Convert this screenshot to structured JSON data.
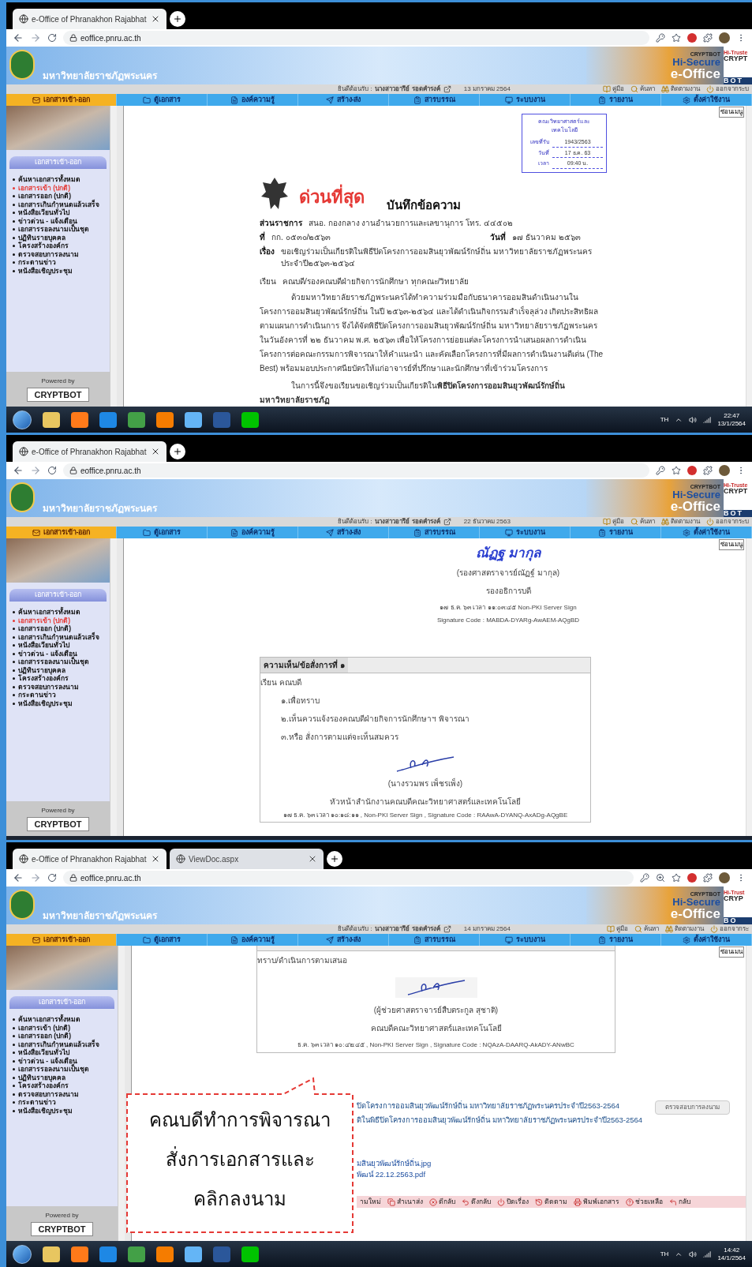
{
  "panels": [
    {
      "browser": {
        "tabs": [
          {
            "title": "e-Office of Phranakhon Rajabhat",
            "selected": true
          }
        ],
        "url": "eoffice.pnru.ac.th",
        "zoom_icon": false
      },
      "site": {
        "university": "มหาวิทยาลัยราชภัฏพระนคร",
        "logo_texts": [
          "CRYPTBOT",
          "Hi-Secure",
          "e-Office",
          "Hi-Truste",
          "CRYPT",
          "BOT"
        ],
        "welcome": "ยินดีต้อนรับ :",
        "user": "นางสาวอารีย์ รอดคำรงค์",
        "date": "13 มกราคม 2564",
        "links": [
          "คู่มือ",
          "ค้นหา",
          "ติดตามงาน",
          "ออกจากระบ"
        ],
        "hide_menu": "ซ่อนเมนู"
      },
      "menu": [
        {
          "label": "เอกสารเข้า-ออก",
          "selected": true
        },
        {
          "label": "ตู้เอกสาร",
          "selected": false
        },
        {
          "label": "องค์ความรู้",
          "selected": false
        },
        {
          "label": "สร้าง-ส่ง",
          "selected": false
        },
        {
          "label": "สารบรรณ",
          "selected": false
        },
        {
          "label": "ระบบงาน",
          "selected": false
        },
        {
          "label": "รายงาน",
          "selected": false
        },
        {
          "label": "ตั้งค่าใช้งาน",
          "selected": false
        }
      ],
      "sidebar": {
        "heading": "เอกสารเข้า-ออก",
        "items": [
          {
            "label": "ค้นหาเอกสารทั้งหมด",
            "selected": false
          },
          {
            "label": "เอกสารเข้า (ปกติ)",
            "selected": true
          },
          {
            "label": "เอกสารออก (ปกติ)",
            "selected": false
          },
          {
            "label": "เอกสารเกินกำหนดแล้วเสร็จ",
            "selected": false
          },
          {
            "label": "หนังสือเวียนทั่วไป",
            "selected": false
          },
          {
            "label": "ข่าวด่วน - แจ้งเตือน",
            "selected": false
          },
          {
            "label": "เอกสารรอลงนามเป็นชุด",
            "selected": false
          },
          {
            "label": "ปฏิทินรายบุคคล",
            "selected": false
          },
          {
            "label": "โครงสร้างองค์กร",
            "selected": false
          },
          {
            "label": "ตรวจสอบการลงนาม",
            "selected": false
          },
          {
            "label": "กระดานข่าว",
            "selected": false
          },
          {
            "label": "หนังสือเชิญประชุม",
            "selected": false
          }
        ],
        "powered_by": "Powered by",
        "vendor": "CRYPTBOT"
      },
      "content": {
        "kind": "memo",
        "stamp": {
          "title": "คณะวิทยาศาสตร์และเทคโนโลยี",
          "rows": [
            {
              "label": "เลขที่รับ",
              "value": "1943/2563"
            },
            {
              "label": "วันที่",
              "value": "17 ธ.ค. 63"
            },
            {
              "label": "เวลา",
              "value": "09:40 น."
            }
          ]
        },
        "urgency": "ด่วนที่สุด",
        "doc_title": "บันทึกข้อความ",
        "fields": [
          {
            "label": "ส่วนราชการ",
            "value": "สนอ. กองกลาง งานอำนวยการและเลขานุการ  โทร. ๔๔๕๐๒"
          },
          {
            "label": "ที่",
            "value": "กก. ๐๕๓๐/๒๕๖๓",
            "extra_label": "วันที่",
            "extra_value": "๑๗ ธันวาคม ๒๕๖๓"
          },
          {
            "label": "เรื่อง",
            "value": "ขอเชิญร่วมเป็นเกียรติในพิธีปิดโครงการออมสินยุวพัฒน์รักษ์ถิ่น มหาวิทยาลัยราชภัฏพระนครประจำปี๒๕๖๓-๒๕๖๔"
          }
        ],
        "salutation": {
          "label": "เรียน",
          "value": "คณบดี/รองคณบดีฝ่ายกิจการนักศึกษา ทุกคณะ/วิทยาลัย"
        },
        "paragraphs": [
          "ด้วยมหาวิทยาลัยราชภัฏพระนครได้ทำความร่วมมือกับธนาคารออมสินดำเนินงานในโครงการออมสินยุวพัฒน์รักษ์ถิ่น ในปี ๒๕๖๓-๒๕๖๔ และได้ดำเนินกิจกรรมสำเร็จลุล่วง เกิดประสิทธิผลตามแผนการดำเนินการ จึงได้จัดพิธีปิดโครงการออมสินยุวพัฒน์รักษ์ถิ่น มหาวิทยาลัยราชภัฏพระนคร ในวันอังคารที่ ๒๒ ธันวาคม พ.ศ. ๒๕๖๓ เพื่อให้โครงการย่อยแต่ละโครงการนำเสนอผลการดำเนินโครงการต่อคณะกรรมการพิจารณาให้คำแนะนำ และคัดเลือกโครงการที่มีผลการดำเนินงานดีเด่น (The Best) พร้อมมอบประกาศนียบัตรให้แก่อาจารย์ที่ปรึกษาและนักศึกษาที่เข้าร่วมโครงการ",
          "ในการนี้จึงขอเรียนขอเชิญร่วมเป็นเกียรติใน**พิธีปิดโครงการออมสินยุวพัฒน์รักษ์ถิ่น มหาวิทยาลัยราชภัฏ**"
        ]
      },
      "taskbar": {
        "language": "TH",
        "time": "22:47",
        "date": "13/1/2564"
      }
    },
    {
      "browser": {
        "tabs": [
          {
            "title": "e-Office of Phranakhon Rajabhat",
            "selected": true
          }
        ],
        "url": "eoffice.pnru.ac.th",
        "zoom_icon": false
      },
      "site": {
        "university": "มหาวิทยาลัยราชภัฏพระนคร",
        "logo_texts": [
          "CRYPTBOT",
          "Hi-Secure",
          "e-Office",
          "Hi-Truste",
          "CRYPT",
          "BOT"
        ],
        "welcome": "ยินดีต้อนรับ :",
        "user": "นางสาวอารีย์ รอดคำรงค์",
        "date": "22 ธันวาคม 2563",
        "links": [
          "คู่มือ",
          "ค้นหา",
          "ติดตามงาน",
          "ออกจากระบ"
        ],
        "hide_menu": "ซ่อนเมนู"
      },
      "menu": [
        {
          "label": "เอกสารเข้า-ออก",
          "selected": true
        },
        {
          "label": "ตู้เอกสาร",
          "selected": false
        },
        {
          "label": "องค์ความรู้",
          "selected": false
        },
        {
          "label": "สร้าง-ส่ง",
          "selected": false
        },
        {
          "label": "สารบรรณ",
          "selected": false
        },
        {
          "label": "ระบบงาน",
          "selected": false
        },
        {
          "label": "รายงาน",
          "selected": false
        },
        {
          "label": "ตั้งค่าใช้งาน",
          "selected": false
        }
      ],
      "sidebar": {
        "heading": "เอกสารเข้า-ออก",
        "items": [
          {
            "label": "ค้นหาเอกสารทั้งหมด",
            "selected": false
          },
          {
            "label": "เอกสารเข้า (ปกติ)",
            "selected": true
          },
          {
            "label": "เอกสารออก (ปกติ)",
            "selected": false
          },
          {
            "label": "เอกสารเกินกำหนดแล้วเสร็จ",
            "selected": false
          },
          {
            "label": "หนังสือเวียนทั่วไป",
            "selected": false
          },
          {
            "label": "ข่าวด่วน - แจ้งเตือน",
            "selected": false
          },
          {
            "label": "เอกสารรอลงนามเป็นชุด",
            "selected": false
          },
          {
            "label": "ปฏิทินรายบุคคล",
            "selected": false
          },
          {
            "label": "โครงสร้างองค์กร",
            "selected": false
          },
          {
            "label": "ตรวจสอบการลงนาม",
            "selected": false
          },
          {
            "label": "กระดานข่าว",
            "selected": false
          },
          {
            "label": "หนังสือเชิญประชุม",
            "selected": false
          }
        ],
        "powered_by": "Powered by",
        "vendor": "CRYPTBOT"
      },
      "content": {
        "kind": "approval",
        "signer": {
          "signature": "ณัฏฐ  มากุล",
          "name": "(รองศาสตราจารย์ณัฏฐ์ มากุล)",
          "position": "รองอธิการบดี",
          "sign_time": "๑๗ ธ.ค. ๖๓ เวลา ๑๑:๐๓:๔๕  Non-PKI Server Sign",
          "signature_code": "Signature Code : MABDA-DYARg-AwAEM-AQgBD"
        },
        "comment": {
          "heading": "ความเห็น/ข้อสั่งการที่ ๑",
          "lines": [
            "เรียน  คณบดี",
            "๑.เพื่อทราบ",
            "๒.เห็นควรแจ้งรองคณบดีฝ่ายกิจการนักศึกษาฯ พิจารณา",
            "๓.หรือ สั่งการตามแต่จะเห็นสมควร"
          ],
          "name": "(นางรวมพร เพ็ชรเพ็ง)",
          "position": "หัวหน้าสำนักงานคณบดีคณะวิทยาศาสตร์และเทคโนโลยี",
          "footer": "๑๗ ธ.ค. ๖๓ เวลา ๑๐:๑๘:๑๑ ,  Non-PKI Server Sign , Signature Code : RAAwA-DYANQ-AxADg-AQgBE"
        }
      }
    },
    {
      "browser": {
        "tabs": [
          {
            "title": "e-Office of Phranakhon Rajabhat",
            "selected": true
          },
          {
            "title": "ViewDoc.aspx",
            "selected": false
          }
        ],
        "url": "eoffice.pnru.ac.th",
        "zoom_icon": true
      },
      "site": {
        "university": "มหาวิทยาลัยราชภัฏพระนคร",
        "logo_texts": [
          "CRYPTBOT",
          "Hi-Secure",
          "e-Office",
          "Hi-Trust",
          "CRYP",
          "BO"
        ],
        "welcome": "ยินดีต้อนรับ :",
        "user": "นางสาวอารีย์ รอดคำรงค์",
        "date": "14 มกราคม 2564",
        "links": [
          "คู่มือ",
          "ค้นหา",
          "ติดตามงาน",
          "ออกจากระ"
        ],
        "hide_menu": "ซ่อนเมน"
      },
      "menu": [
        {
          "label": "เอกสารเข้า-ออก",
          "selected": true
        },
        {
          "label": "ตู้เอกสาร",
          "selected": false
        },
        {
          "label": "องค์ความรู้",
          "selected": false
        },
        {
          "label": "สร้าง-ส่ง",
          "selected": false
        },
        {
          "label": "สารบรรณ",
          "selected": false
        },
        {
          "label": "ระบบงาน",
          "selected": false
        },
        {
          "label": "รายงาน",
          "selected": false
        },
        {
          "label": "ตั้งค่าใช้งาน",
          "selected": false
        }
      ],
      "sidebar": {
        "heading": "เอกสารเข้า-ออก",
        "items": [
          {
            "label": "ค้นหาเอกสารทั้งหมด",
            "selected": false
          },
          {
            "label": "เอกสารเข้า (ปกติ)",
            "selected": false
          },
          {
            "label": "เอกสารออก (ปกติ)",
            "selected": false
          },
          {
            "label": "เอกสารเกินกำหนดแล้วเสร็จ",
            "selected": false
          },
          {
            "label": "หนังสือเวียนทั่วไป",
            "selected": false
          },
          {
            "label": "ข่าวด่วน - แจ้งเตือน",
            "selected": false
          },
          {
            "label": "เอกสารรอลงนามเป็นชุด",
            "selected": false
          },
          {
            "label": "ปฏิทินรายบุคคล",
            "selected": false
          },
          {
            "label": "โครงสร้างองค์กร",
            "selected": false
          },
          {
            "label": "ตรวจสอบการลงนาม",
            "selected": false
          },
          {
            "label": "กระดานข่าว",
            "selected": false
          },
          {
            "label": "หนังสือเชิญประชุม",
            "selected": false
          }
        ],
        "powered_by": "Powered by",
        "vendor": "CRYPTBOT"
      },
      "content": {
        "kind": "decision",
        "comment": {
          "text": "ทราบ/ดำเนินการตามเสนอ",
          "name": "(ผู้ช่วยศาสตราจารย์สืบตระกูล สุชาติ)",
          "position": "คณบดีคณะวิทยาศาสตร์และเทคโนโลยี",
          "footer": "ธ.ค. ๖๓ เวลา ๑๐:๔๒:๔๕ ,  Non-PKI Server Sign , Signature Code : NQAzA-DAARQ-AkADY-ANwBC"
        },
        "subject_lines": [
          "ปิดโครงการออมสินยุวพัฒน์รักษ์ถิ่น มหาวิทยาลัยราชภัฏพระนครประจำปี2563-2564",
          "ติในพิธีปิดโครงการออมสินยุวพัฒน์รักษ์ถิ่น มหาวิทยาลัยราชภัฏพระนครประจำปี2563-2564"
        ],
        "verify_button": "ตรวจสอบการลงนาม",
        "attachments": [
          "มสินยุวพัฒน์รักษ์ถิ่น.jpg",
          "พัฒน์ 22.12.2563.pdf"
        ],
        "actions": [
          "ามใหม่",
          "สำเนาส่ง",
          "ตีกลับ",
          "ดึงกลับ",
          "ปิดเรื่อง",
          "ติดตาม",
          "พิมพ์เอกสาร",
          "ช่วยเหลือ",
          "กลับ"
        ],
        "callout": [
          "คณบดีทำการพิจารณา",
          "สั่งการเอกสารและ",
          "คลิกลงนาม"
        ]
      },
      "taskbar": {
        "language": "TH",
        "time": "14:42",
        "date": "14/1/2564"
      }
    }
  ]
}
